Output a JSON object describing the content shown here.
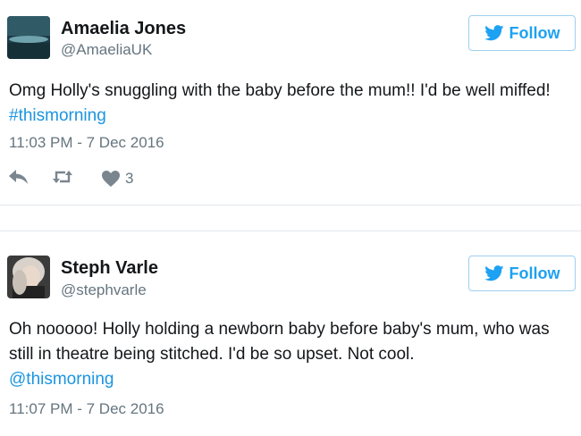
{
  "tweets": [
    {
      "name": "Amaelia Jones",
      "handle": "@AmaeliaUK",
      "follow_label": "Follow",
      "text_before": "Omg Holly's snuggling with the baby before the mum!! I'd be well miffed! ",
      "hashtag": "#thismorning",
      "timestamp": "11:03 PM - 7 Dec 2016",
      "like_count": "3",
      "avatar_icon": "landscape-avatar"
    },
    {
      "name": "Steph Varle",
      "handle": "@stephvarle",
      "follow_label": "Follow",
      "text_before": "Oh nooooo! Holly holding a newborn baby before baby's mum, who was still in theatre being stitched. I'd be so upset. Not cool.",
      "mention": "@thismorning",
      "timestamp": "11:07 PM - 7 Dec 2016",
      "avatar_icon": "portrait-avatar"
    }
  ],
  "colors": {
    "twitter_blue": "#1da1f2",
    "link_blue": "#1b95e0",
    "secondary_text": "#66757f"
  }
}
